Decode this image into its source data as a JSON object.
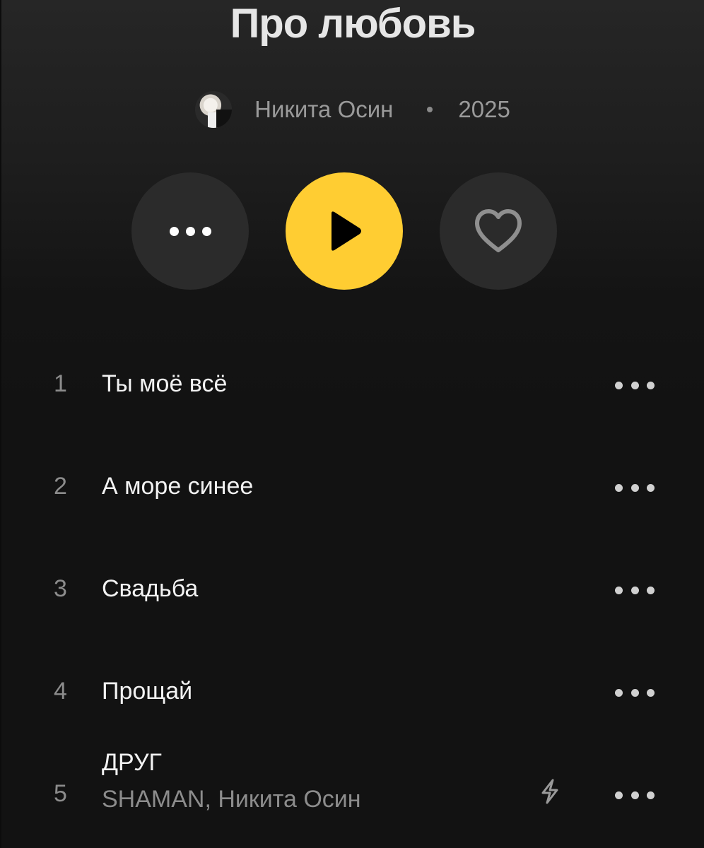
{
  "album": {
    "title": "Про любовь",
    "artist": "Никита Осин",
    "year": "2025"
  },
  "actions": {
    "more_icon": "ellipsis-icon",
    "play_icon": "play-icon",
    "like_icon": "heart-outline-icon"
  },
  "colors": {
    "accent": "#ffcd32",
    "background": "#121212",
    "button_bg": "#2b2b2b",
    "secondary_text": "#8c8c8c"
  },
  "tracks": [
    {
      "number": "1",
      "title": "Ты моё всё",
      "artists": ""
    },
    {
      "number": "2",
      "title": "А море синее",
      "artists": ""
    },
    {
      "number": "3",
      "title": "Свадьба",
      "artists": ""
    },
    {
      "number": "4",
      "title": "Прощай",
      "artists": ""
    },
    {
      "number": "5",
      "title": "ДРУГ",
      "artists": "SHAMAN, Никита Осин",
      "explicit_icon": "lightning-icon"
    }
  ]
}
